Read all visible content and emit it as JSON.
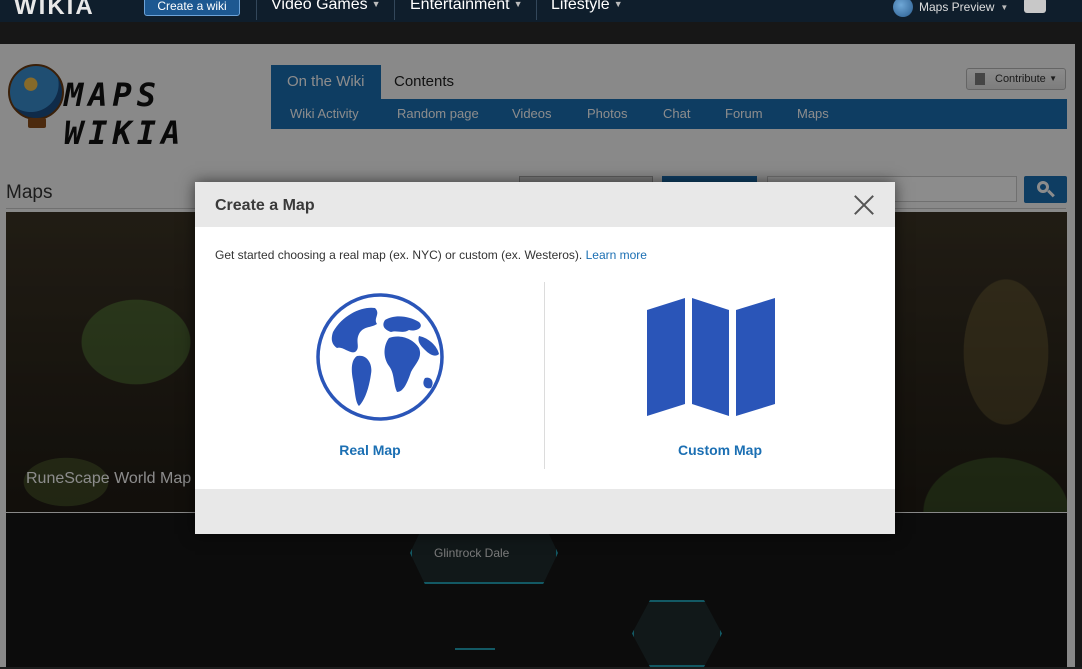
{
  "global_nav": {
    "logo": "WIKIA",
    "create_wiki": "Create a wiki",
    "hubs": [
      "Video Games",
      "Entertainment",
      "Lifestyle"
    ],
    "user": "Maps Preview"
  },
  "wiki": {
    "wordmark": "MAPS WIKIA",
    "tabs": [
      "On the Wiki",
      "Contents"
    ],
    "subnav": [
      "Wiki Activity",
      "Random page",
      "Videos",
      "Photos",
      "Chat",
      "Forum",
      "Maps"
    ],
    "contribute": "Contribute",
    "page_title": "Maps"
  },
  "maps": {
    "first_map_label": "RuneScape World Map",
    "second_map_label": "Glintrock Dale"
  },
  "modal": {
    "title": "Create a Map",
    "intro": "Get started choosing a real map (ex. NYC) or custom (ex. Westeros).",
    "learn_more": "Learn more",
    "real_map": "Real Map",
    "custom_map": "Custom Map"
  },
  "colors": {
    "accent": "#1b6fb3",
    "icon_blue": "#2a55b8",
    "global_nav_bg": "#0f1e2c"
  }
}
